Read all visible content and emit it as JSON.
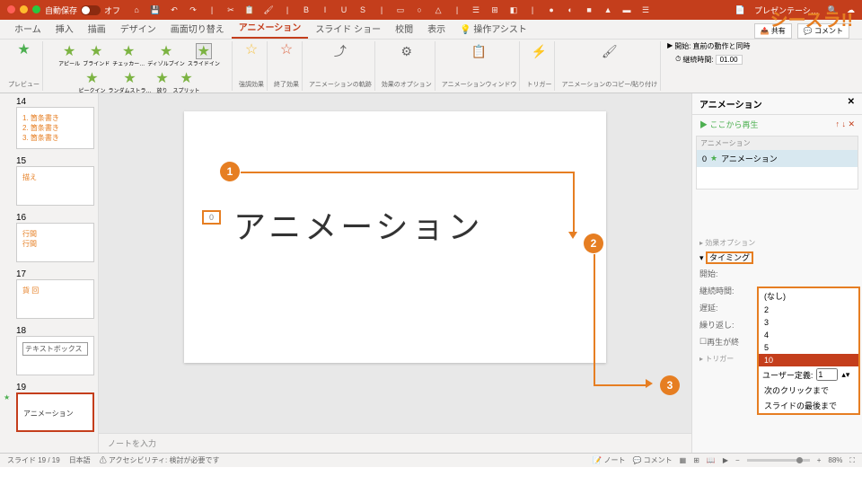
{
  "brand": "シースラ!!",
  "titlebar": {
    "autosave_label": "自動保存",
    "autosave_state": "オフ",
    "doc_title": "プレゼンテーシ…"
  },
  "tabs": {
    "items": [
      "ホーム",
      "挿入",
      "描画",
      "デザイン",
      "画面切り替え",
      "アニメーション",
      "スライド ショー",
      "校閲",
      "表示",
      "操作アシスト"
    ],
    "active": 5
  },
  "ribbon": {
    "preview": "プレビュー",
    "effects": [
      "アピール",
      "ブラインド",
      "チェッカー…",
      "ディゾルブイン",
      "スライドイン",
      "ピークイン",
      "ランダムストラ…",
      "放り",
      "スプリット"
    ],
    "selected_effect": 4,
    "groups": {
      "emphasis": "強調効果",
      "exit": "終了効果",
      "motion": "アニメーションの軌跡",
      "options": "効果のオプション",
      "order": "アニメーションウィンドウ",
      "trigger": "トリガー",
      "copy": "アニメーションのコピー/貼り付け"
    },
    "timing": {
      "start_lbl": "開始:",
      "start_val": "直前の動作と同時",
      "duration_lbl": "継続時間:",
      "duration_val": "01.00"
    }
  },
  "ribbon_right": {
    "share": "共有",
    "comment": "コメント"
  },
  "thumbs": [
    {
      "n": "14",
      "lines": [
        "1. 箇条書き",
        "2. 箇条書き",
        "3. 箇条書き"
      ]
    },
    {
      "n": "15",
      "lines": [
        "描え"
      ]
    },
    {
      "n": "16",
      "lines": [
        "行間",
        "行間"
      ]
    },
    {
      "n": "17",
      "lines": [
        "貨 回"
      ]
    },
    {
      "n": "18",
      "lines": [
        "テキストボックス"
      ],
      "boxed": true
    },
    {
      "n": "19",
      "lines": [
        "アニメーション"
      ],
      "sel": true
    }
  ],
  "canvas": {
    "tag": "0",
    "text": "アニメーション",
    "notes": "ノートを入力"
  },
  "panel": {
    "title": "アニメーション",
    "play": "ここから再生",
    "list_hdr": "アニメーション",
    "item": {
      "idx": "0",
      "label": "アニメーション"
    },
    "sec_effect": "効果オプション",
    "sec_timing": "タイミング",
    "rows": {
      "start": "開始:",
      "duration": "継続時間:",
      "delay": "遅延:",
      "repeat": "繰り返し:",
      "rewind": "再生が終"
    },
    "trigger": "トリガー"
  },
  "dropdown": {
    "options": [
      "(なし)",
      "2",
      "3",
      "4",
      "5",
      "10"
    ],
    "selected": 5,
    "user_label": "ユーザー定義:",
    "user_val": "1",
    "extra1": "次のクリックまで",
    "extra2": "スライドの最後まで"
  },
  "status": {
    "slide": "スライド 19 / 19",
    "lang": "日本語",
    "acc": "アクセシビリティ: 検討が必要です",
    "notes": "ノート",
    "comments": "コメント",
    "zoom": "88%"
  },
  "callouts": {
    "c1": "1",
    "c2": "2",
    "c3": "3"
  }
}
